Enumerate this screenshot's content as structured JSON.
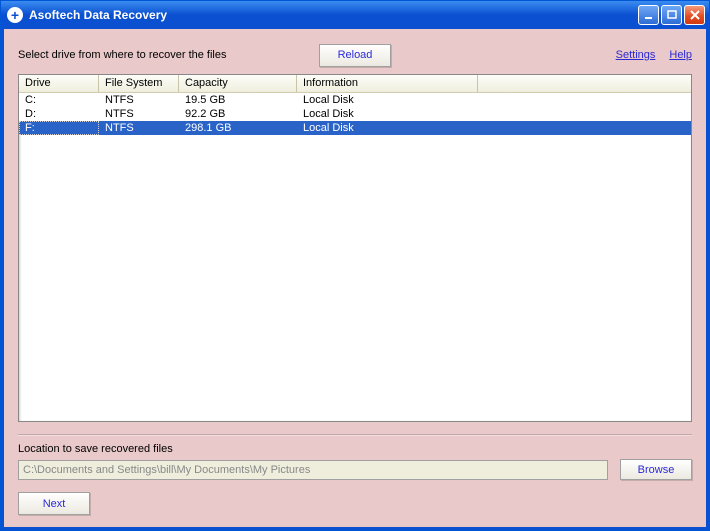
{
  "window": {
    "title": "Asoftech Data Recovery"
  },
  "toolbar": {
    "prompt": "Select drive from where to recover the files",
    "reload_label": "Reload",
    "settings_label": "Settings",
    "help_label": "Help"
  },
  "columns": {
    "drive": "Drive",
    "fs": "File System",
    "capacity": "Capacity",
    "info": "Information"
  },
  "drives": [
    {
      "drive": "C:",
      "fs": "NTFS",
      "capacity": "19.5 GB",
      "info": "Local Disk",
      "selected": false
    },
    {
      "drive": "D:",
      "fs": "NTFS",
      "capacity": "92.2 GB",
      "info": "Local Disk",
      "selected": false
    },
    {
      "drive": "F:",
      "fs": "NTFS",
      "capacity": "298.1 GB",
      "info": "Local Disk",
      "selected": true
    }
  ],
  "recovery": {
    "label": "Location to save recovered files",
    "path": "C:\\Documents and Settings\\bill\\My Documents\\My Pictures",
    "browse_label": "Browse",
    "next_label": "Next"
  }
}
